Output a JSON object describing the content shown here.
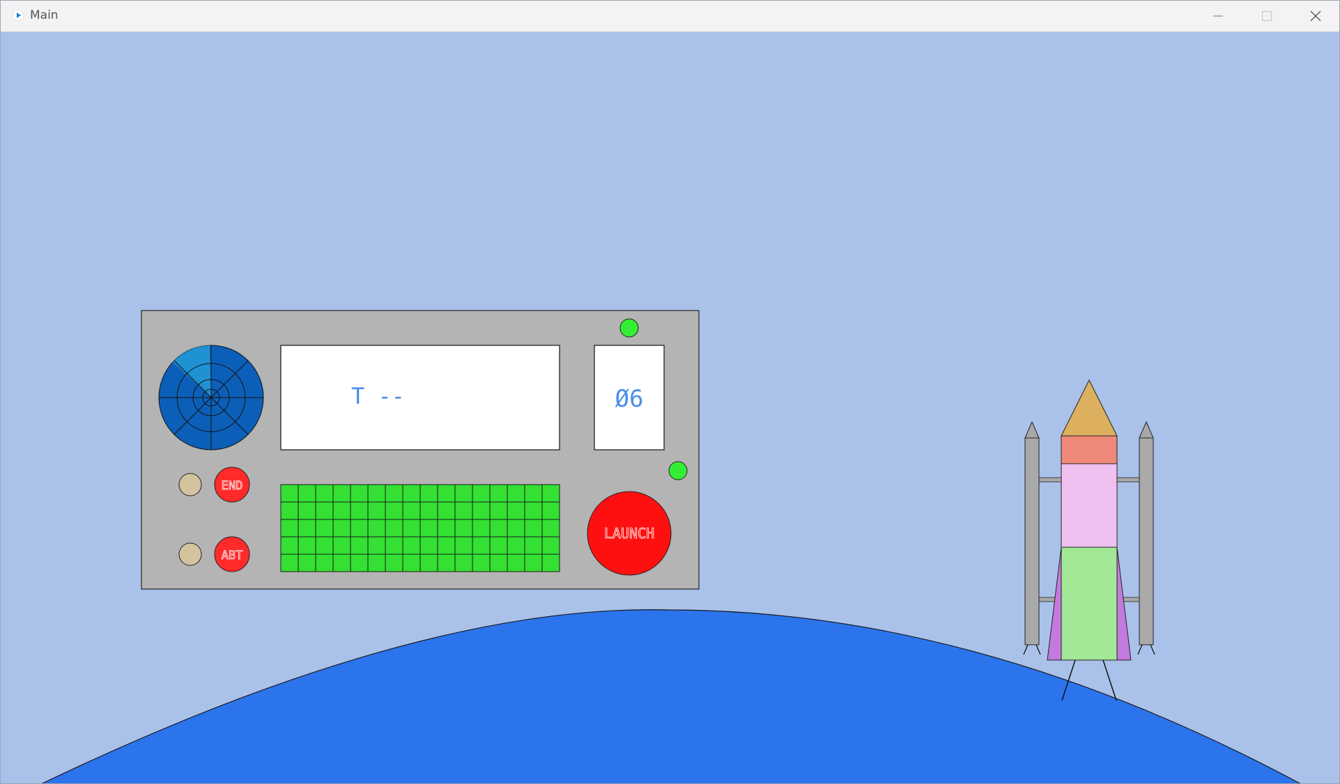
{
  "window": {
    "title": "Main"
  },
  "icons": {
    "app": "play-icon",
    "minimize": "minimize-icon",
    "maximize": "maximize-icon",
    "close": "close-icon"
  },
  "panel": {
    "countdown_display": "T --",
    "counter_display": "Ø6",
    "end_button_label": "END",
    "abort_button_label": "ABT",
    "launch_button_label": "LAUNCH"
  },
  "colors": {
    "sky": "#aac2ea",
    "planet": "#2b74ec",
    "panel": "#b4b4b4",
    "radar": "#0c5fb8",
    "radar_sweep": "#1e92d2",
    "display_text": "#4a8fe6",
    "status_light": "#33ee33",
    "red_button": "#ff2a2a",
    "indicator": "#d2c49e",
    "grid_cell": "#33e033",
    "rocket_nose": "#dcb05e",
    "rocket_band": "#ef8a7a",
    "rocket_mid": "#f0c0f0",
    "rocket_lower": "#a2e897",
    "rocket_fins": "#c37ade",
    "booster": "#a9a9a9"
  }
}
